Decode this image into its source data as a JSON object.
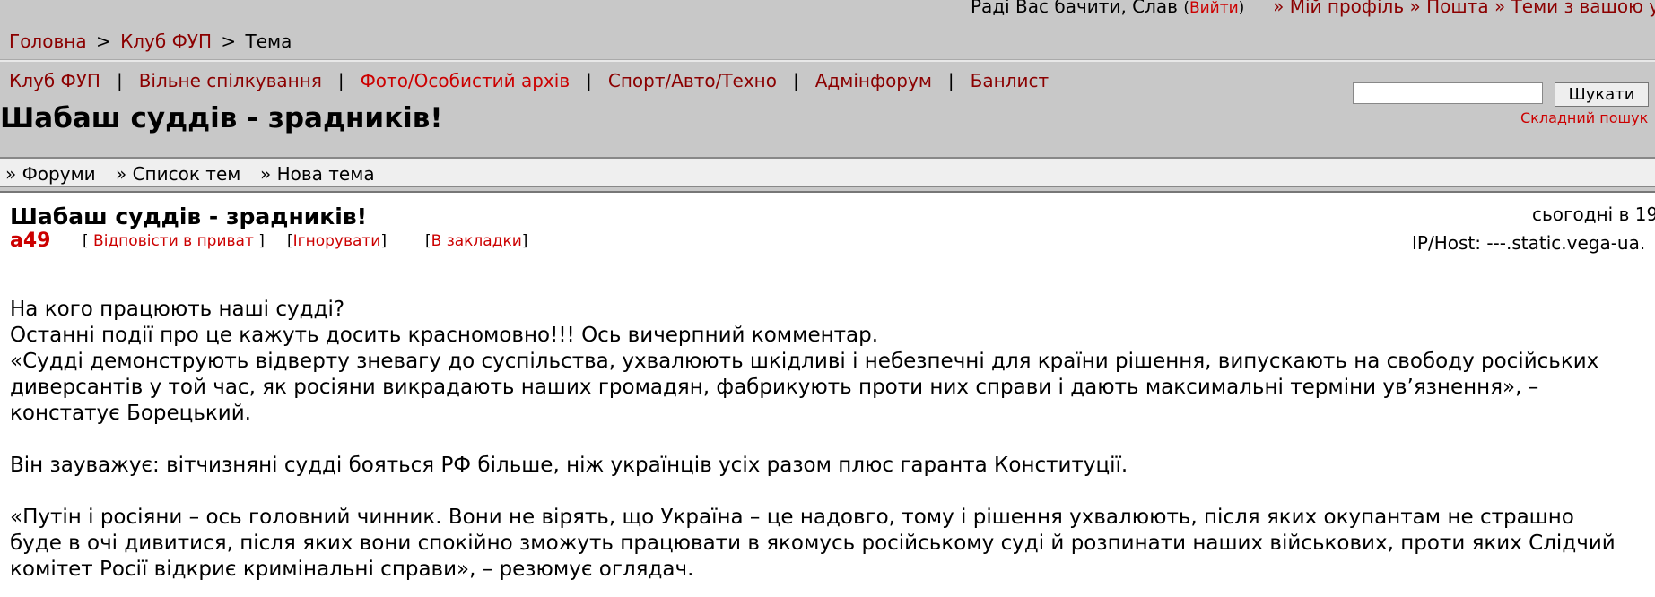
{
  "header": {
    "welcome_text": "Раді Вас бачити, Слав",
    "logout_open": "(",
    "logout_label": "Вийти",
    "logout_close": ")",
    "links": [
      {
        "prefix": "»",
        "label": "Мій профіль"
      },
      {
        "prefix": "»",
        "label": "Пошта"
      },
      {
        "prefix": "»",
        "label": "Теми з вашою уча"
      }
    ]
  },
  "breadcrumb": {
    "items": [
      "Головна",
      "Клуб ФУП",
      "Тема"
    ],
    "separator": ">"
  },
  "sections": {
    "items": [
      "Клуб ФУП",
      "Вільне спілкування",
      "Фото/Особистий архів",
      "Спорт/Авто/Техно",
      "Адмінфорум",
      "Банлист"
    ],
    "separator": "|"
  },
  "search": {
    "input_value": "",
    "button_label": "Шукати",
    "advanced_label": "Складний пошук"
  },
  "page_title": "Шабаш суддів - зрадників!",
  "forum_nav": {
    "items": [
      "» Форуми",
      "» Список тем",
      "» Нова тема"
    ]
  },
  "post": {
    "title": "Шабаш суддів - зрадників!",
    "author": "a49",
    "actions": [
      {
        "open": "[",
        "label": " Відповісти в приват ",
        "close": "]"
      },
      {
        "open": "[",
        "label": "Ігнорувати",
        "close": "]"
      },
      {
        "open": "[",
        "label": "В закладки",
        "close": "]"
      }
    ],
    "time": "сьогодні в 19",
    "ip_host": "IP/Host: ---.static.vega-ua.",
    "body": [
      "На кого працюють наші судді?",
      "Останні події про це кажуть досить  красномовно!!! Ось  вичерпний комментар.",
      "«Судді демонструють відверту зневагу до суспільства, ухвалюють  шкідливі і небезпечні для країни рішення, випускають на свободу російських",
      "диверсантів у той час, як росіяни викрадають наших громадян, фабрикують проти них справи і дають максимальні терміни ув’язнення», –",
      "констатує Борецький.",
      "",
      "Він зауважує: вітчизняні судді бояться РФ більше, ніж українців усіх разом плюс гаранта Конституції.",
      "",
      "«Путін і росіяни – ось головний чинник. Вони не вірять, що Україна – це надовго, тому і рішення ухвалюють, після яких окупантам не страшно",
      "буде в очі дивитися, після яких вони спокійно зможуть працювати в якомусь російському суді й розпинати наших військових, проти яких Слідчий",
      "комітет Росії відкриє кримінальні справи», – резюмує оглядач."
    ]
  },
  "colors": {
    "background": "#c8c8c8",
    "link": "#8b0000",
    "accent_red": "#cc0000",
    "panel": "#ffffff"
  }
}
